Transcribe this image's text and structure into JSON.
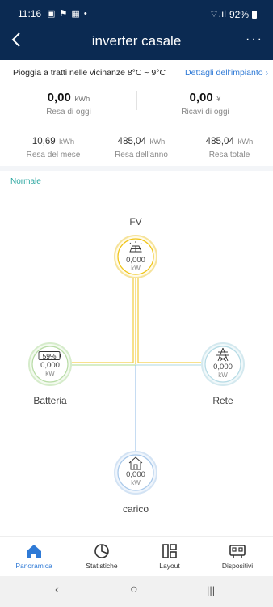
{
  "status_bar": {
    "time": "11:16",
    "icons": "▣ ⚑ ▦ •",
    "signal": "⌔.ıl",
    "battery": "92%"
  },
  "header": {
    "back_icon": "back-arrow-icon",
    "title": "inverter casale",
    "more": "···"
  },
  "summary": {
    "weather": "Pioggia a tratti nelle vicinanze 8°C ~ 9°C",
    "details_link": "Dettagli dell'impianto",
    "today_yield": {
      "value": "0,00",
      "unit": "kWh",
      "label": "Resa di oggi"
    },
    "today_revenue": {
      "value": "0,00",
      "unit": "¥",
      "label": "Ricavi di oggi"
    },
    "month_yield": {
      "value": "10,69",
      "unit": "kWh",
      "label": "Resa del mese"
    },
    "year_yield": {
      "value": "485,04",
      "unit": "kWh",
      "label": "Resa dell'anno"
    },
    "total_yield": {
      "value": "485,04",
      "unit": "kWh",
      "label": "Resa totale"
    }
  },
  "flow": {
    "state": "Normale",
    "pv": {
      "label": "FV",
      "value": "0,000",
      "unit": "kW",
      "icon": "solar-panel-icon",
      "color": "#f0c419"
    },
    "battery": {
      "label": "Batteria",
      "value": "0,000",
      "unit": "kW",
      "soc": "59%",
      "icon": "battery-icon",
      "color": "#8fd16a"
    },
    "grid": {
      "label": "Rete",
      "value": "0,000",
      "unit": "kW",
      "icon": "power-tower-icon",
      "color": "#7fc8d8"
    },
    "load": {
      "label": "carico",
      "value": "0,000",
      "unit": "kW",
      "icon": "home-icon",
      "color": "#7fb0e0"
    }
  },
  "tabs": [
    {
      "label": "Panoramica",
      "icon": "home-icon",
      "active": true
    },
    {
      "label": "Statistiche",
      "icon": "pie-chart-icon",
      "active": false
    },
    {
      "label": "Layout",
      "icon": "layout-icon",
      "active": false
    },
    {
      "label": "Dispositivi",
      "icon": "device-icon",
      "active": false
    }
  ],
  "system_nav": {
    "back": "‹",
    "home": "○",
    "recents": "|||"
  }
}
